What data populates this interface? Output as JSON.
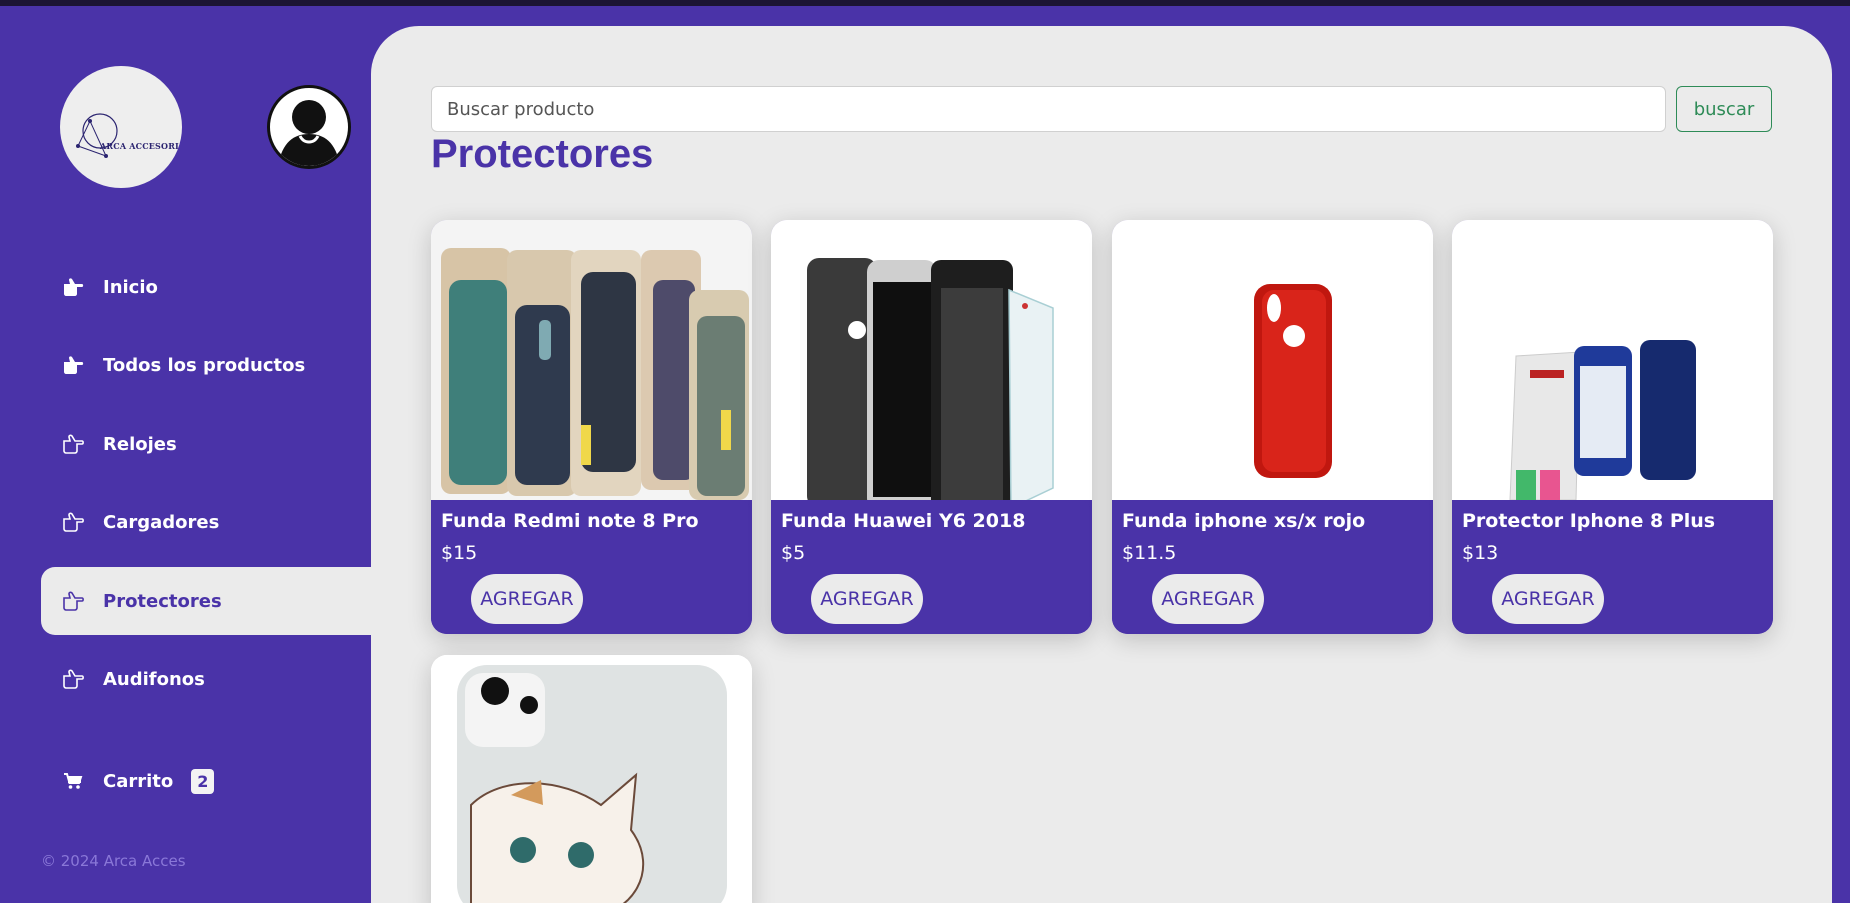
{
  "brand": {
    "logo_text": "ARCA ACCESORIOS"
  },
  "sidebar": {
    "items": [
      {
        "label": "Inicio",
        "icon": "hand-point-right-solid-icon"
      },
      {
        "label": "Todos los productos",
        "icon": "hand-point-right-solid-icon"
      },
      {
        "label": "Relojes",
        "icon": "hand-point-right-outline-icon"
      },
      {
        "label": "Cargadores",
        "icon": "hand-point-right-outline-icon"
      },
      {
        "label": "Protectores",
        "icon": "hand-point-right-outline-icon",
        "active": true
      },
      {
        "label": "Audifonos",
        "icon": "hand-point-right-outline-icon"
      }
    ],
    "cart": {
      "label": "Carrito",
      "count": "2",
      "icon": "shopping-cart-icon"
    },
    "copyright": "© 2024 Arca Acces"
  },
  "search": {
    "placeholder": "Buscar producto",
    "button_label": "buscar"
  },
  "main": {
    "title": "Protectores",
    "products": [
      {
        "name": "Funda Redmi note 8 Pro",
        "price": "$15",
        "button": "AGREGAR"
      },
      {
        "name": "Funda Huawei Y6 2018",
        "price": "$5",
        "button": "AGREGAR"
      },
      {
        "name": "Funda iphone xs/x rojo",
        "price": "$11.5",
        "button": "AGREGAR"
      },
      {
        "name": "Protector Iphone 8 Plus",
        "price": "$13",
        "button": "AGREGAR"
      },
      {
        "name": "",
        "price": "",
        "button": ""
      }
    ]
  },
  "colors": {
    "primary": "#4a33a8",
    "panel": "#ebebeb",
    "search_button": "#2e8b57",
    "topbar": "#1c1533"
  }
}
